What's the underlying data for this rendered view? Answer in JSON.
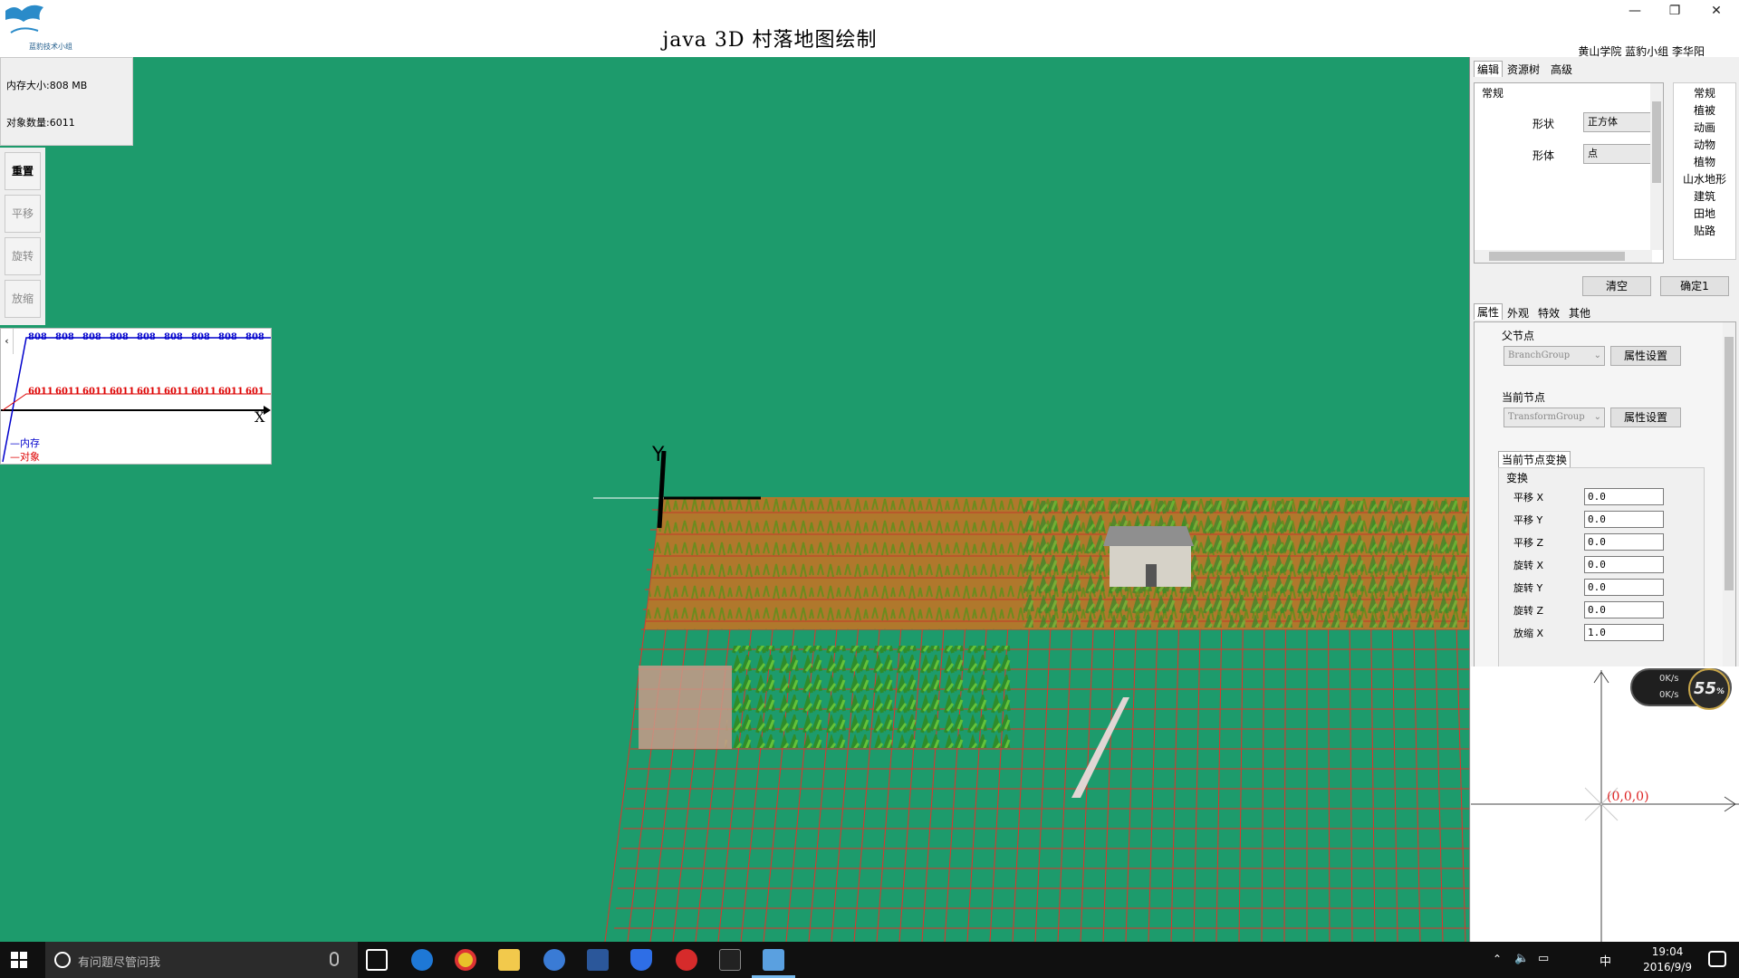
{
  "window": {
    "title": "java 3D 村落地图绘制",
    "author": "黄山学院 蓝豹小组 李华阳",
    "logo_text": "蓝豹技术小组"
  },
  "info": {
    "memory": "内存大小:808 MB",
    "objects": "对象数量:6011"
  },
  "tools": [
    "重置",
    "平移",
    "旋转",
    "放缩"
  ],
  "monitor": {
    "memory_values": [
      "808",
      "808",
      "808",
      "808",
      "808",
      "808",
      "808",
      "808",
      "808"
    ],
    "object_values": [
      "6011",
      "6011",
      "6011",
      "6011",
      "6011",
      "6011",
      "6011",
      "6011",
      "601"
    ],
    "axis_label": "X",
    "legend_memory": "—内存",
    "legend_objects": "—对象",
    "colors": {
      "memory": "#0000cc",
      "objects": "#dd0000"
    }
  },
  "top_tabs": [
    "编辑",
    "资源树",
    "高级"
  ],
  "general": {
    "group": "常规",
    "shape_label": "形状",
    "shape_value": "正方体",
    "form_label": "形体",
    "form_value": "点"
  },
  "categories": [
    "常规",
    "植被",
    "动画",
    "动物",
    "植物",
    "山水地形",
    "建筑",
    "田地",
    "贴路"
  ],
  "actions": {
    "clear": "清空",
    "confirm": "确定1"
  },
  "prop_tabs": [
    "属性",
    "外观",
    "特效",
    "其他"
  ],
  "parent_node": {
    "label": "父节点",
    "value": "BranchGroup",
    "button": "属性设置"
  },
  "current_node": {
    "label": "当前节点",
    "value": "TransformGroup",
    "button": "属性设置"
  },
  "transform_tab": "当前节点变换",
  "transform_group": "变换",
  "transform_rows": [
    {
      "label": "平移 X",
      "value": "0.0"
    },
    {
      "label": "平移 Y",
      "value": "0.0"
    },
    {
      "label": "平移 Z",
      "value": "0.0"
    },
    {
      "label": "旋转 X",
      "value": "0.0"
    },
    {
      "label": "旋转 Y",
      "value": "0.0"
    },
    {
      "label": "旋转 Z",
      "value": "0.0"
    },
    {
      "label": "放缩 X",
      "value": "1.0"
    }
  ],
  "speed_widget": {
    "up": "0K/s",
    "down": "0K/s",
    "percent": "55",
    "unit": "%"
  },
  "minimap_label": "(0,0,0)",
  "taskbar": {
    "search_placeholder": "有问题尽管问我",
    "clock_time": "19:04",
    "clock_date": "2016/9/9",
    "ime": "中"
  }
}
